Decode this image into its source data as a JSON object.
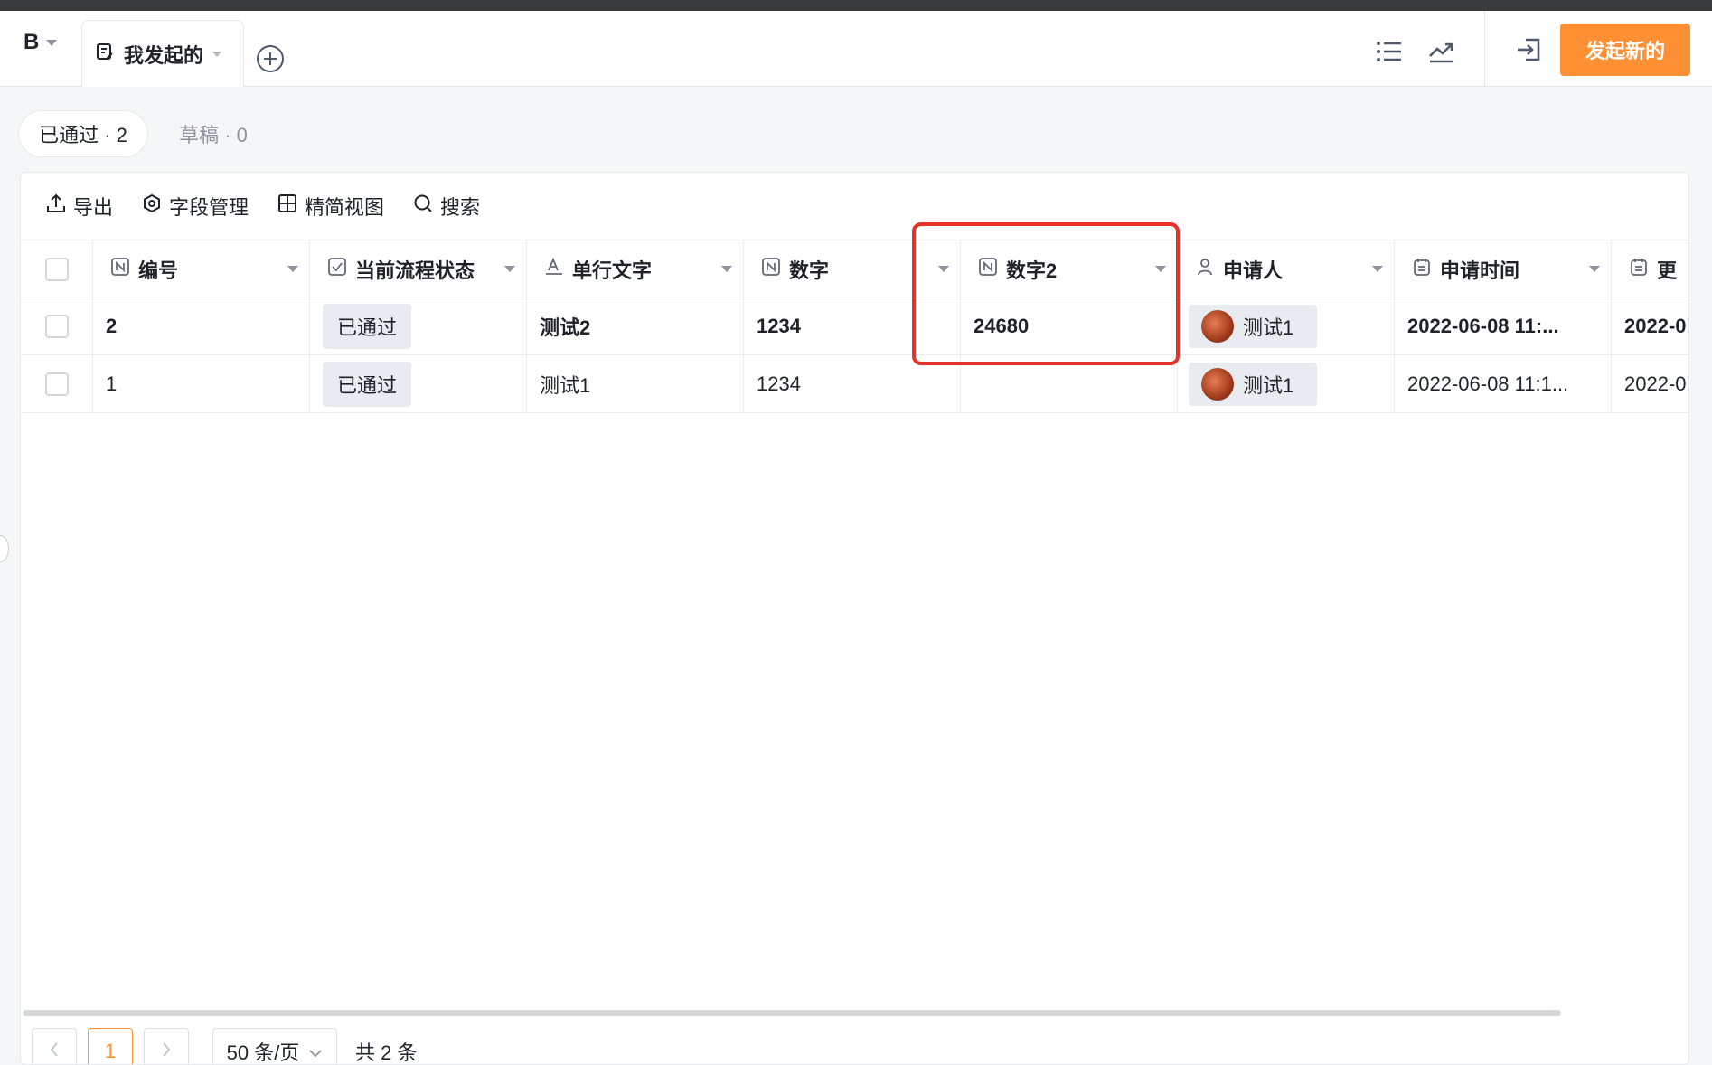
{
  "header": {
    "workspace": "B",
    "view_tab": "我发起的",
    "primary_button": "发起新的",
    "icons": [
      "list-icon",
      "trend-icon",
      "exit-icon"
    ]
  },
  "filters": {
    "approved": "已通过 · 2",
    "draft": "草稿 · 0"
  },
  "toolbar": {
    "export": "导出",
    "field_manage": "字段管理",
    "compact_view": "精简视图",
    "search": "搜索"
  },
  "table": {
    "columns": [
      "编号",
      "当前流程状态",
      "单行文字",
      "数字",
      "数字2",
      "申请人",
      "申请时间",
      "更"
    ],
    "rows": [
      {
        "id": "2",
        "status": "已通过",
        "text": "测试2",
        "num": "1234",
        "num2": "24680",
        "applicant": "测试1",
        "time": "2022-06-08 11:...",
        "updated": "2022-0"
      },
      {
        "id": "1",
        "status": "已通过",
        "text": "测试1",
        "num": "1234",
        "num2": "",
        "applicant": "测试1",
        "time": "2022-06-08 11:1...",
        "updated": "2022-0"
      }
    ]
  },
  "pagination": {
    "current": "1",
    "page_size": "50 条/页",
    "total": "共 2 条"
  },
  "colors": {
    "accent": "#ff8f33",
    "highlight": "#e63329"
  }
}
